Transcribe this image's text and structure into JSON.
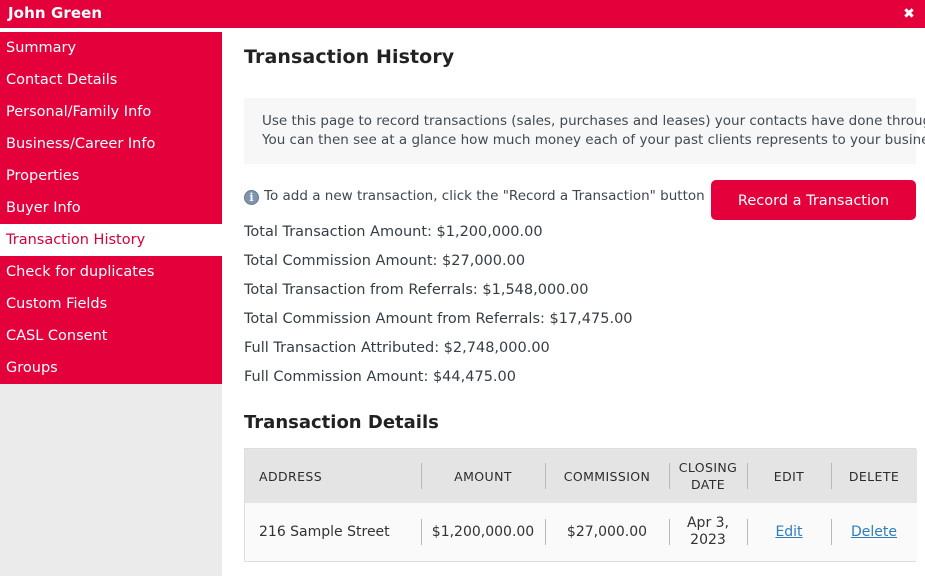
{
  "titlebar": {
    "contact_name": "John Green",
    "close_icon": "close-icon",
    "close_glyph": "✖",
    "brand_color": "#e4003a"
  },
  "sidebar": {
    "items": [
      {
        "label": "Summary",
        "active": false
      },
      {
        "label": "Contact Details",
        "active": false
      },
      {
        "label": "Personal/Family Info",
        "active": false
      },
      {
        "label": "Business/Career Info",
        "active": false
      },
      {
        "label": "Properties",
        "active": false
      },
      {
        "label": "Buyer Info",
        "active": false
      },
      {
        "label": "Transaction History",
        "active": true
      },
      {
        "label": "Check for duplicates",
        "active": false
      },
      {
        "label": "Custom Fields",
        "active": false
      },
      {
        "label": "CASL Consent",
        "active": false
      },
      {
        "label": "Groups",
        "active": false
      }
    ],
    "active_text_color": "#d5003c",
    "background_color": "#ebebeb"
  },
  "main": {
    "page_title": "Transaction History",
    "description": {
      "line1": "Use this page to record transactions (sales, purchases and leases) your contacts have done through you.",
      "line2": "You can then see at a glance how much money each of your past clients represents to your business."
    },
    "hint": {
      "icon": "info-icon",
      "text": "To add a new transaction, click the \"Record a Transaction\" button"
    },
    "record_button_label": "Record a Transaction",
    "totals": [
      "Total Transaction Amount: $1,200,000.00",
      "Total Commission Amount: $27,000.00",
      "Total Transaction from Referrals: $1,548,000.00",
      "Total Commission Amount from Referrals: $17,475.00",
      "Full Transaction Attributed: $2,748,000.00",
      "Full Commission Amount: $44,475.00"
    ],
    "details": {
      "title": "Transaction Details",
      "columns": {
        "address": "ADDRESS",
        "amount": "AMOUNT",
        "commission": "COMMISSION",
        "closing_date_line1": "CLOSING",
        "closing_date_line2": "DATE",
        "edit": "EDIT",
        "delete": "DELETE"
      },
      "rows": [
        {
          "address": "216 Sample Street",
          "amount": "$1,200,000.00",
          "commission": "$27,000.00",
          "closing_date_line1": "Apr 3,",
          "closing_date_line2": "2023",
          "edit_label": "Edit",
          "delete_label": "Delete"
        }
      ],
      "link_color": "#2e7ebb"
    }
  }
}
